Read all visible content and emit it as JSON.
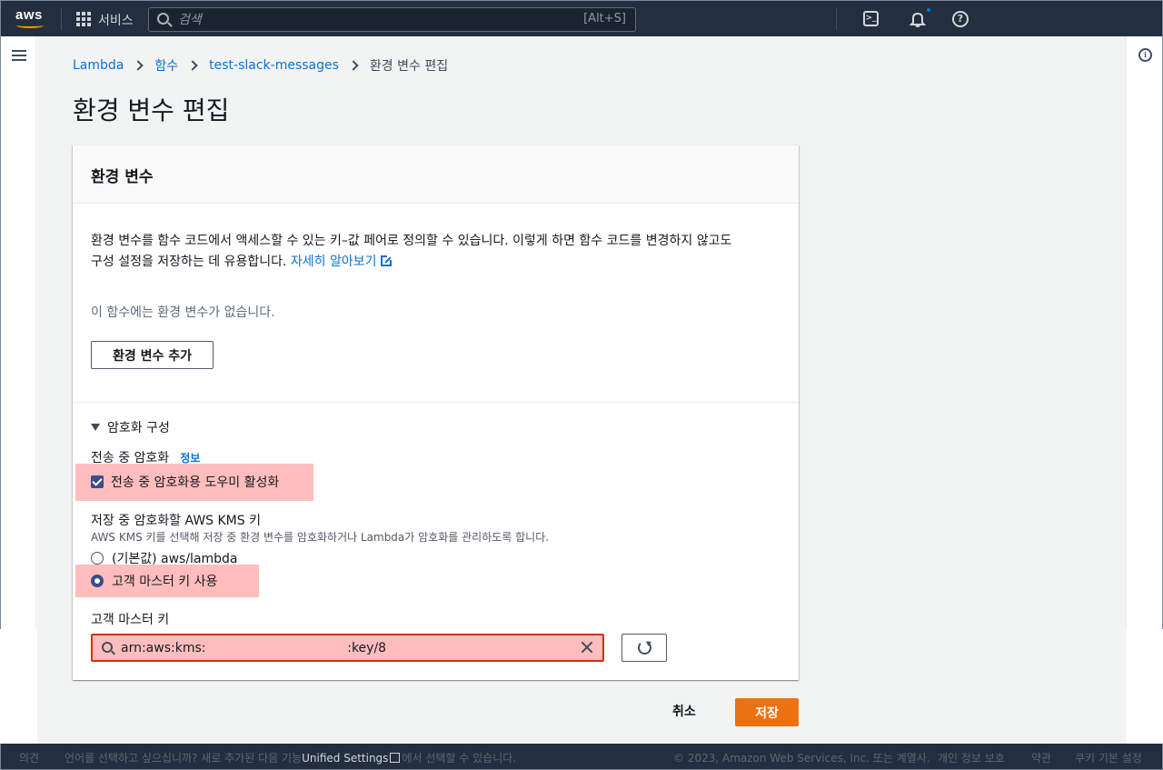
{
  "topnav": {
    "logo_text": "aws",
    "services_label": "서비스",
    "search_placeholder": "검색",
    "search_shortcut": "[Alt+S]",
    "icons": [
      "cloudshell-icon",
      "bell-icon",
      "help-icon"
    ]
  },
  "breadcrumb": [
    {
      "label": "Lambda",
      "link": true
    },
    {
      "label": "함수",
      "link": true
    },
    {
      "label": "test-slack-messages",
      "link": true
    },
    {
      "label": "환경 변수 편집",
      "link": false
    }
  ],
  "page_title": "환경 변수 편집",
  "card": {
    "title": "환경 변수",
    "description_line1": "환경 변수를 함수 코드에서 액세스할 수 있는 키–값 페어로 정의할 수 있습니다. 이렇게 하면 함수 코드를 변경하지 않고도",
    "description_line2": "구성 설정을 저장하는 데 유용합니다.",
    "learn_more": "자세히 알아보기",
    "empty_note": "이 함수에는 환경 변수가 없습니다.",
    "add_button": "환경 변수 추가",
    "encryption": {
      "section_title": "암호화 구성",
      "in_transit_label": "전송 중 암호화",
      "info_link": "정보",
      "enable_helpers_label": "전송 중 암호화용 도우미 활성화",
      "enable_helpers_checked": true,
      "kms_label": "저장 중 암호화할 AWS KMS 키",
      "kms_hint": "AWS KMS 키를 선택해 저장 중 환경 변수를 암호화하거나 Lambda가 암호화를 관리하도록 합니다.",
      "option_default": "(기본값) aws/lambda",
      "option_customer": "고객 마스터 키 사용",
      "selected_option": "customer",
      "cmk_label": "고객 마스터 키",
      "cmk_value": "arn:aws:kms:                                   :key/8"
    }
  },
  "actions": {
    "cancel": "취소",
    "save": "저장"
  },
  "footer": {
    "feedback": "의견",
    "language_prompt_pre": "언어를 선택하고 싶으십니까? 새로 추가된 다음 기능",
    "unified_settings": "Unified Settings",
    "language_prompt_post": "에서 선택할 수 있습니다.",
    "copyright": "© 2023, Amazon Web Services, Inc. 또는 계열사.",
    "privacy": "개인 정보 보호",
    "terms": "약관",
    "cookies": "쿠키 기본 설정"
  },
  "colors": {
    "nav_bg": "#232f3e",
    "link": "#0972d3",
    "primary_button": "#ec7211",
    "highlight": "#ffbdbd",
    "checkbox": "#3b4b8c"
  }
}
